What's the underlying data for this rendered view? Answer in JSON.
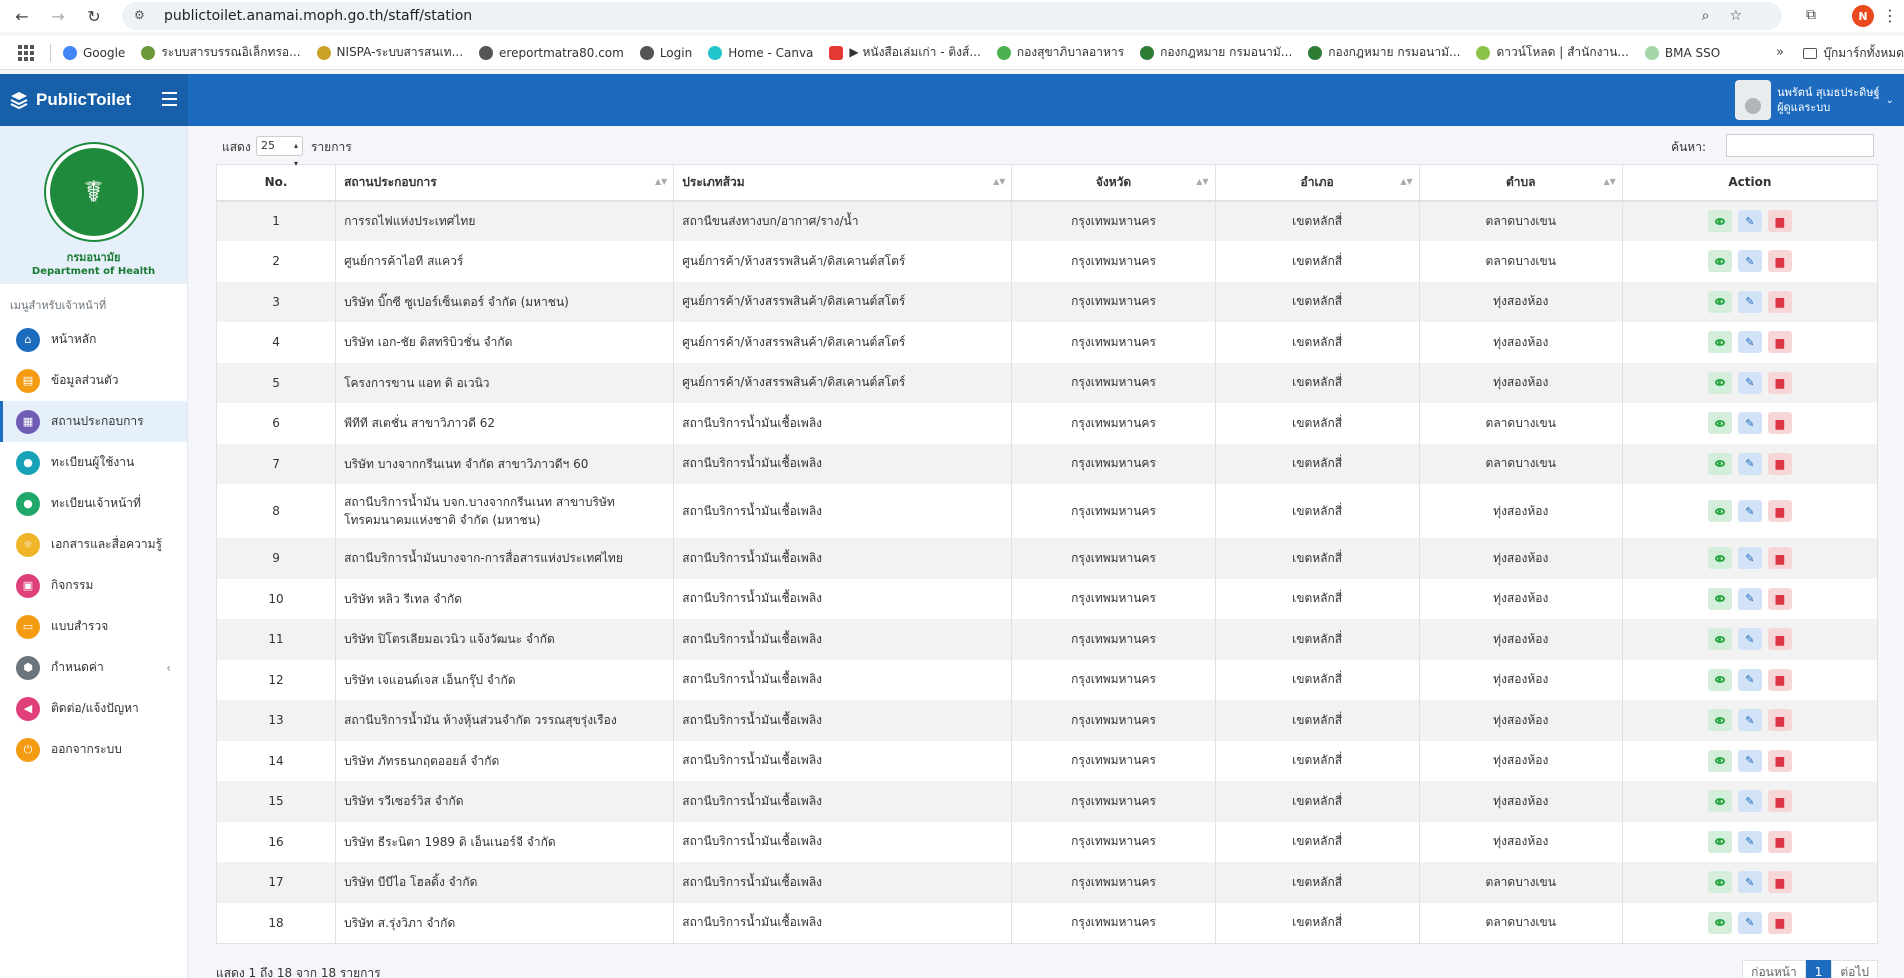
{
  "browser": {
    "url": "publictoilet.anamai.moph.go.th/staff/station",
    "profile_initial": "N",
    "bookmarks": [
      "Google",
      "ระบบสารบรรณอิเล็กทรอ...",
      "NISPA-ระบบสารสนเท...",
      "ereportmatra80.com",
      "Login",
      "Home - Canva",
      "▶ หนังสือเล่มเก่า - ติงส์...",
      "กองสุขาภิบาลอาหาร",
      "กองกฎหมาย กรมอนามั...",
      "กองกฎหมาย กรมอนามั...",
      "ดาวน์โหลด | สำนักงาน...",
      "BMA SSO"
    ],
    "bookmarks_more": "»",
    "bookmarks_folder": "บุ๊กมาร์กทั้งหมด"
  },
  "header": {
    "brand": "PublicToilet",
    "user_name": "นพรัตน์ สุเมธประดิษฐ์",
    "user_role": "ผู้ดูแลระบบ"
  },
  "sidebar": {
    "logo_th": "กรมอนามัย",
    "logo_en": "Department of Health",
    "menu_head": "เมนูสำหรับเจ้าหน้าที่",
    "items": [
      {
        "label": "หน้าหลัก",
        "color": "#1c6bbf",
        "icon": "home-icon"
      },
      {
        "label": "ข้อมูลส่วนตัว",
        "color": "#f39c12",
        "icon": "id-card-icon"
      },
      {
        "label": "สถานประกอบการ",
        "color": "#6f5db5",
        "icon": "building-icon"
      },
      {
        "label": "ทะเบียนผู้ใช้งาน",
        "color": "#17a2b8",
        "icon": "user-icon"
      },
      {
        "label": "ทะเบียนเจ้าหน้าที่",
        "color": "#20a86b",
        "icon": "staff-icon"
      },
      {
        "label": "เอกสารและสื่อความรู้",
        "color": "#f0b429",
        "icon": "lightbulb-icon"
      },
      {
        "label": "กิจกรรม",
        "color": "#e0407a",
        "icon": "image-icon"
      },
      {
        "label": "แบบสำรวจ",
        "color": "#f39c12",
        "icon": "survey-icon"
      },
      {
        "label": "กำหนดค่า",
        "color": "#6c757d",
        "icon": "settings-icon"
      },
      {
        "label": "ติดต่อ/แจ้งปัญหา",
        "color": "#e0407a",
        "icon": "megaphone-icon"
      },
      {
        "label": "ออกจากระบบ",
        "color": "#f39c12",
        "icon": "power-icon"
      }
    ]
  },
  "controls": {
    "show_label": "แสดง",
    "page_length": "25",
    "rows_label": "รายการ",
    "search_label": "ค้นหา:",
    "search_value": ""
  },
  "table": {
    "headers": [
      "No.",
      "สถานประกอบการ",
      "ประเภทส้วม",
      "จังหวัด",
      "อำเภอ",
      "ตำบล",
      "Action"
    ],
    "rows": [
      {
        "no": "1",
        "name": "การรถไฟแห่งประเทศไทย",
        "type": "สถานีขนส่งทางบก/อากาศ/ราง/น้ำ",
        "prov": "กรุงเทพมหานคร",
        "dist": "เขตหลักสี่",
        "sub": "ตลาดบางเขน"
      },
      {
        "no": "2",
        "name": "ศูนย์การค้าไอที สแควร์",
        "type": "ศูนย์การค้า/ห้างสรรพสินค้า/ดิสเคานต์สโตร์",
        "prov": "กรุงเทพมหานคร",
        "dist": "เขตหลักสี่",
        "sub": "ตลาดบางเขน"
      },
      {
        "no": "3",
        "name": "บริษัท บิ๊กซี ซูเปอร์เซ็นเตอร์ จำกัด (มหาชน)",
        "type": "ศูนย์การค้า/ห้างสรรพสินค้า/ดิสเคานต์สโตร์",
        "prov": "กรุงเทพมหานคร",
        "dist": "เขตหลักสี่",
        "sub": "ทุ่งสองห้อง"
      },
      {
        "no": "4",
        "name": "บริษัท เอก-ชัย ดิสทริบิวชั่น จำกัด",
        "type": "ศูนย์การค้า/ห้างสรรพสินค้า/ดิสเคานต์สโตร์",
        "prov": "กรุงเทพมหานคร",
        "dist": "เขตหลักสี่",
        "sub": "ทุ่งสองห้อง"
      },
      {
        "no": "5",
        "name": "โครงการขาน แอท ดิ อเวนิว",
        "type": "ศูนย์การค้า/ห้างสรรพสินค้า/ดิสเคานต์สโตร์",
        "prov": "กรุงเทพมหานคร",
        "dist": "เขตหลักสี่",
        "sub": "ทุ่งสองห้อง"
      },
      {
        "no": "6",
        "name": "พีทีที สเตชั่น สาขาวิภาวดี 62",
        "type": "สถานีบริการน้ำมันเชื้อเพลิง",
        "prov": "กรุงเทพมหานคร",
        "dist": "เขตหลักสี่",
        "sub": "ตลาดบางเขน"
      },
      {
        "no": "7",
        "name": "บริษัท บางจากกรีนเนท จำกัด สาขาวิภาวดีฯ 60",
        "type": "สถานีบริการน้ำมันเชื้อเพลิง",
        "prov": "กรุงเทพมหานคร",
        "dist": "เขตหลักสี่",
        "sub": "ตลาดบางเขน"
      },
      {
        "no": "8",
        "name": "สถานีบริการน้ำมัน บจก.บางจากกรีนเนท สาขาบริษัท โทรคมนาคมแห่งชาติ จำกัด (มหาชน)",
        "type": "สถานีบริการน้ำมันเชื้อเพลิง",
        "prov": "กรุงเทพมหานคร",
        "dist": "เขตหลักสี่",
        "sub": "ทุ่งสองห้อง"
      },
      {
        "no": "9",
        "name": "สถานีบริการน้ำมันบางจาก-การสื่อสารแห่งประเทศไทย",
        "type": "สถานีบริการน้ำมันเชื้อเพลิง",
        "prov": "กรุงเทพมหานคร",
        "dist": "เขตหลักสี่",
        "sub": "ทุ่งสองห้อง"
      },
      {
        "no": "10",
        "name": "บริษัท หลิว รีเทล จำกัด",
        "type": "สถานีบริการน้ำมันเชื้อเพลิง",
        "prov": "กรุงเทพมหานคร",
        "dist": "เขตหลักสี่",
        "sub": "ทุ่งสองห้อง"
      },
      {
        "no": "11",
        "name": "บริษัท ปิโตรเลียมอเวนิว แจ้งวัฒนะ จำกัด",
        "type": "สถานีบริการน้ำมันเชื้อเพลิง",
        "prov": "กรุงเทพมหานคร",
        "dist": "เขตหลักสี่",
        "sub": "ทุ่งสองห้อง"
      },
      {
        "no": "12",
        "name": "บริษัท เจแอนด์เจส เอ็นกรุ๊ป จำกัด",
        "type": "สถานีบริการน้ำมันเชื้อเพลิง",
        "prov": "กรุงเทพมหานคร",
        "dist": "เขตหลักสี่",
        "sub": "ทุ่งสองห้อง"
      },
      {
        "no": "13",
        "name": "สถานีบริการน้ำมัน ห้างหุ้นส่วนจำกัด วรรณสุขรุ่งเรือง",
        "type": "สถานีบริการน้ำมันเชื้อเพลิง",
        "prov": "กรุงเทพมหานคร",
        "dist": "เขตหลักสี่",
        "sub": "ทุ่งสองห้อง"
      },
      {
        "no": "14",
        "name": "บริษัท ภัทรธนกฤตออยล์ จำกัด",
        "type": "สถานีบริการน้ำมันเชื้อเพลิง",
        "prov": "กรุงเทพมหานคร",
        "dist": "เขตหลักสี่",
        "sub": "ทุ่งสองห้อง"
      },
      {
        "no": "15",
        "name": "บริษัท รวีเซอร์วิส จำกัด",
        "type": "สถานีบริการน้ำมันเชื้อเพลิง",
        "prov": "กรุงเทพมหานคร",
        "dist": "เขตหลักสี่",
        "sub": "ทุ่งสองห้อง"
      },
      {
        "no": "16",
        "name": "บริษัท ธีระนิตา 1989 ดิ เอ็นเนอร์จี จำกัด",
        "type": "สถานีบริการน้ำมันเชื้อเพลิง",
        "prov": "กรุงเทพมหานคร",
        "dist": "เขตหลักสี่",
        "sub": "ทุ่งสองห้อง"
      },
      {
        "no": "17",
        "name": "บริษัท บีบีไอ โฮลดิ้ง จำกัด",
        "type": "สถานีบริการน้ำมันเชื้อเพลิง",
        "prov": "กรุงเทพมหานคร",
        "dist": "เขตหลักสี่",
        "sub": "ตลาดบางเขน"
      },
      {
        "no": "18",
        "name": "บริษัท ส.รุ่งวิภา จำกัด",
        "type": "สถานีบริการน้ำมันเชื้อเพลิง",
        "prov": "กรุงเทพมหานคร",
        "dist": "เขตหลักสี่",
        "sub": "ตลาดบางเขน"
      }
    ]
  },
  "footer": {
    "info": "แสดง 1 ถึง 18 จาก 18 รายการ",
    "prev": "ก่อนหน้า",
    "page": "1",
    "next": "ต่อไป"
  }
}
